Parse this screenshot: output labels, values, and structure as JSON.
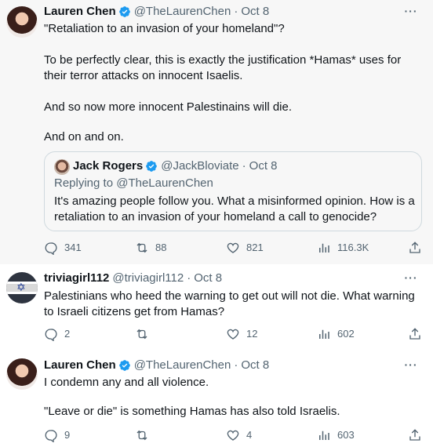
{
  "tweets": [
    {
      "name": "Lauren Chen",
      "handle": "@TheLaurenChen",
      "time": "Oct 8",
      "paragraphs": [
        "\"Retaliation to an invasion of your homeland\"?",
        "To be perfectly clear, this is exactly the justification *Hamas* uses for their terror attacks on innocent Isaelis.",
        "And so now more innocent Palestinains will die.",
        "And on and on."
      ],
      "quote": {
        "name": "Jack Rogers",
        "handle": "@JackBloviate",
        "time": "Oct 8",
        "replying_prefix": "Replying to ",
        "replying_to": "@TheLaurenChen",
        "text": "It's amazing people follow you. What a misinformed opinion. How is a retaliation to an invasion of your homeland a call to genocide?"
      },
      "stats": {
        "replies": "341",
        "retweets": "88",
        "likes": "821",
        "views": "116.3K"
      }
    },
    {
      "name": "triviagirl112",
      "handle": "@triviagirl112",
      "time": "Oct 8",
      "text": "Palestinians who heed the warning to get out will not die.  What warning to Israeli citizens get from Hamas?",
      "stats": {
        "replies": "2",
        "retweets": "",
        "likes": "12",
        "views": "602"
      }
    },
    {
      "name": "Lauren Chen",
      "handle": "@TheLaurenChen",
      "time": "Oct 8",
      "paragraphs": [
        "I condemn any and all violence.",
        "\"Leave or die\" is something Hamas has also told Israelis."
      ],
      "stats": {
        "replies": "9",
        "retweets": "",
        "likes": "4",
        "views": "603"
      }
    }
  ],
  "ui": {
    "dot": "·",
    "more": "···"
  },
  "colors": {
    "verified": "#1d9bf0",
    "muted": "#536471",
    "border": "#cfd9de",
    "highlight_bg": "#f7f7f7"
  }
}
